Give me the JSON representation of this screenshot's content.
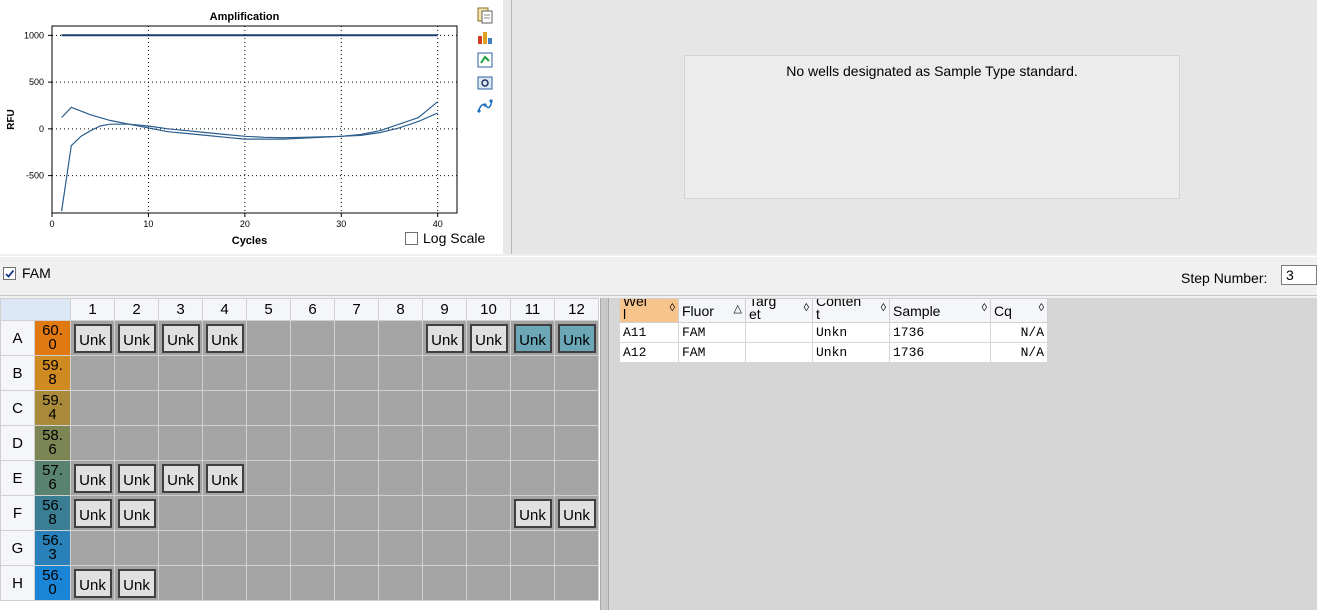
{
  "chart": {
    "title": "Amplification",
    "xlabel": "Cycles",
    "ylabel": "RFU",
    "log_scale_label": "Log Scale",
    "log_scale_checked": false
  },
  "chart_data": {
    "type": "line",
    "title": "Amplification",
    "xlabel": "Cycles",
    "ylabel": "RFU",
    "xlim": [
      0,
      42
    ],
    "ylim": [
      -900,
      1100
    ],
    "xticks": [
      0,
      10,
      20,
      30,
      40
    ],
    "yticks": [
      1000,
      500,
      0,
      -500
    ],
    "grid": true,
    "series": [
      {
        "x": [
          1,
          40
        ],
        "y": [
          1000,
          1000
        ]
      },
      {
        "x": [
          1,
          2,
          3,
          4,
          5,
          6,
          8,
          10,
          12,
          14,
          16,
          18,
          20,
          22,
          24,
          26,
          28,
          30,
          32,
          34,
          36,
          38,
          40
        ],
        "y": [
          -880,
          -180,
          -80,
          -20,
          30,
          50,
          50,
          30,
          0,
          -20,
          -40,
          -60,
          -80,
          -90,
          -95,
          -90,
          -85,
          -80,
          -70,
          -40,
          10,
          80,
          170
        ]
      },
      {
        "x": [
          1,
          2,
          4,
          6,
          8,
          10,
          12,
          14,
          16,
          18,
          20,
          22,
          24,
          26,
          28,
          30,
          32,
          34,
          36,
          38,
          40
        ],
        "y": [
          120,
          230,
          150,
          90,
          50,
          10,
          -30,
          -50,
          -70,
          -90,
          -110,
          -110,
          -110,
          -100,
          -90,
          -80,
          -60,
          -20,
          50,
          120,
          290
        ]
      }
    ]
  },
  "toolbar_icons": [
    "copy-icon",
    "export-chart-icon",
    "refresh-icon",
    "zoom-icon",
    "curve-fit-icon"
  ],
  "std_curve": {
    "message": "No wells designated as Sample Type standard."
  },
  "fluor": {
    "fam_label": "FAM",
    "fam_checked": true,
    "step_label": "Step Number:",
    "step_value": "3"
  },
  "plate": {
    "columns": [
      "1",
      "2",
      "3",
      "4",
      "5",
      "6",
      "7",
      "8",
      "9",
      "10",
      "11",
      "12"
    ],
    "rows": [
      {
        "label": "A",
        "temp": "60.\n0",
        "temp_color": "#e07a10",
        "wells": [
          "Unk",
          "Unk",
          "Unk",
          "Unk",
          "",
          "",
          "",
          "",
          "Unk",
          "Unk",
          "Unk*",
          "Unk*"
        ]
      },
      {
        "label": "B",
        "temp": "59.\n8",
        "temp_color": "#cf8a22",
        "wells": [
          "",
          "",
          "",
          "",
          "",
          "",
          "",
          "",
          "",
          "",
          "",
          ""
        ]
      },
      {
        "label": "C",
        "temp": "59.\n4",
        "temp_color": "#a88a3a",
        "wells": [
          "",
          "",
          "",
          "",
          "",
          "",
          "",
          "",
          "",
          "",
          "",
          ""
        ]
      },
      {
        "label": "D",
        "temp": "58.\n6",
        "temp_color": "#7c8655",
        "wells": [
          "",
          "",
          "",
          "",
          "",
          "",
          "",
          "",
          "",
          "",
          "",
          ""
        ]
      },
      {
        "label": "E",
        "temp": "57.\n6",
        "temp_color": "#5a8270",
        "wells": [
          "Unk",
          "Unk",
          "Unk",
          "Unk",
          "",
          "",
          "",
          "",
          "",
          "",
          "",
          ""
        ]
      },
      {
        "label": "F",
        "temp": "56.\n8",
        "temp_color": "#3a7e94",
        "wells": [
          "Unk",
          "Unk",
          "",
          "",
          "",
          "",
          "",
          "",
          "",
          "",
          "Unk",
          "Unk"
        ]
      },
      {
        "label": "G",
        "temp": "56.\n3",
        "temp_color": "#2a80b8",
        "wells": [
          "",
          "",
          "",
          "",
          "",
          "",
          "",
          "",
          "",
          "",
          "",
          ""
        ]
      },
      {
        "label": "H",
        "temp": "56.\n0",
        "temp_color": "#1a84d6",
        "wells": [
          "Unk",
          "Unk",
          "",
          "",
          "",
          "",
          "",
          "",
          "",
          "",
          "",
          ""
        ]
      }
    ]
  },
  "results": {
    "headers": [
      {
        "label": "Wel\nl",
        "sort": "◊",
        "sorted": true
      },
      {
        "label": "Fluor",
        "sort": "△",
        "sorted": false
      },
      {
        "label": "Targ\net",
        "sort": "◊",
        "sorted": false
      },
      {
        "label": "Conten\nt",
        "sort": "◊",
        "sorted": false
      },
      {
        "label": "Sample",
        "sort": "◊",
        "sorted": false
      },
      {
        "label": "Cq",
        "sort": "◊",
        "sorted": false
      }
    ],
    "rows": [
      [
        "A11",
        "FAM",
        "",
        "Unkn",
        "1736",
        "N/A"
      ],
      [
        "A12",
        "FAM",
        "",
        "Unkn",
        "1736",
        "N/A"
      ]
    ]
  }
}
